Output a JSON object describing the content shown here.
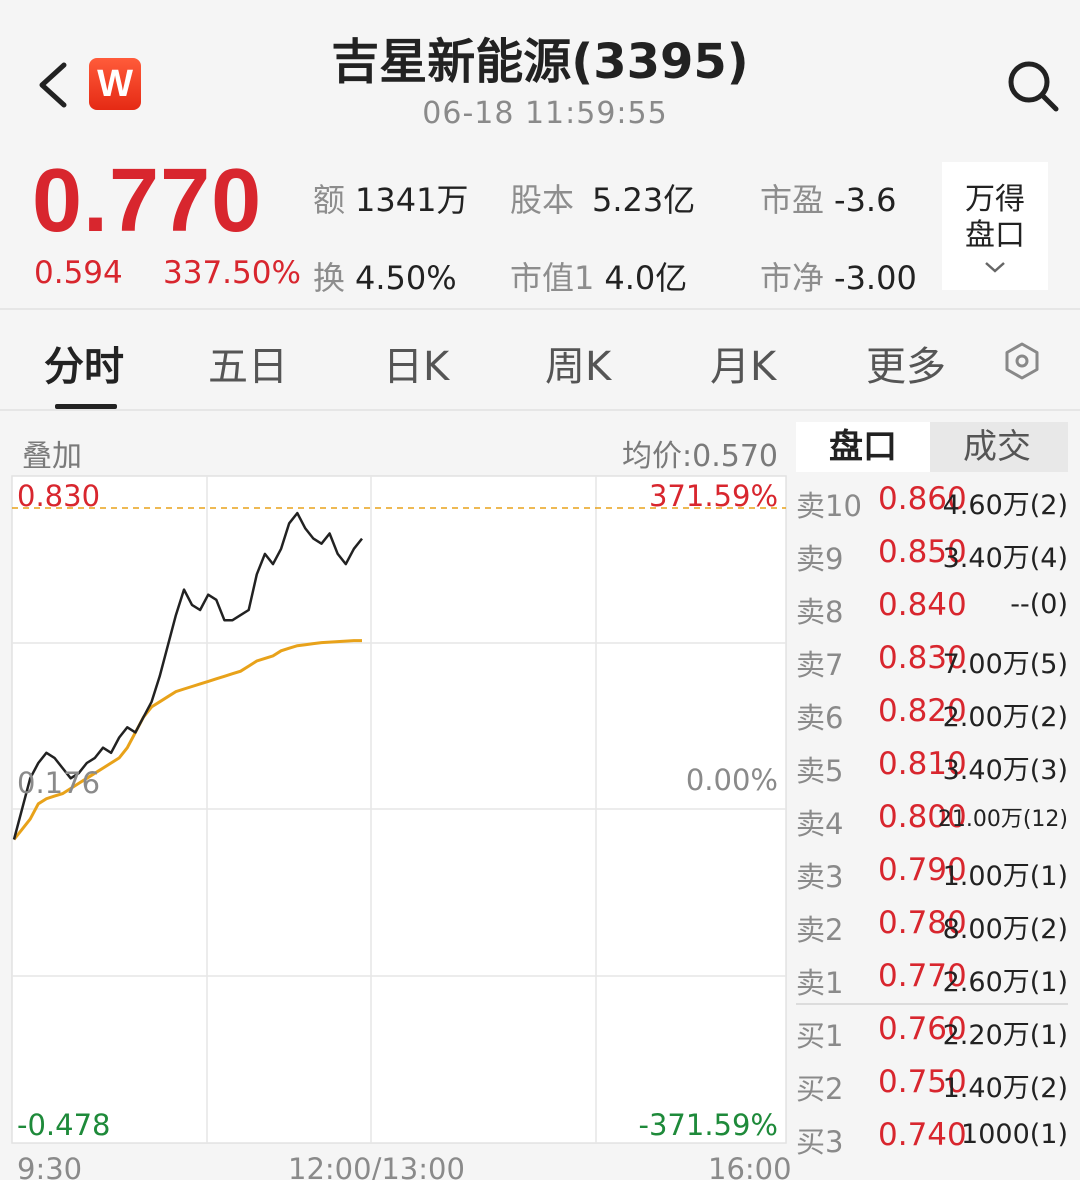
{
  "header": {
    "title": "吉星新能源(3395)",
    "timestamp": "06-18 11:59:55",
    "logo_letter": "W"
  },
  "quote": {
    "price": "0.770",
    "change": "0.594",
    "change_pct": "337.50%",
    "stats": [
      {
        "label": "额",
        "value": "1341万"
      },
      {
        "label": "股本",
        "value": "5.23亿"
      },
      {
        "label": "市盈",
        "value": "-3.6"
      },
      {
        "label": "换",
        "value": "4.50%"
      },
      {
        "label": "市值1",
        "value": "4.0亿"
      },
      {
        "label": "市净",
        "value": "-3.00"
      }
    ],
    "wande_label_1": "万得",
    "wande_label_2": "盘口"
  },
  "tabs": [
    "分时",
    "五日",
    "日K",
    "周K",
    "月K",
    "更多"
  ],
  "chart": {
    "overlay_label": "叠加",
    "avg_price_label": "均价:0.570",
    "top_price": "0.830",
    "top_pct": "371.59%",
    "mid_price": "0.176",
    "mid_pct": "0.00%",
    "bottom_price": "-0.478",
    "bottom_pct": "-371.59%",
    "time_labels": [
      "9:30",
      "12:00/13:00",
      "16:00"
    ]
  },
  "order_book": {
    "tabs": [
      "盘口",
      "成交"
    ],
    "rows": [
      {
        "level": "卖10",
        "price": "0.860",
        "volume": "4.60万(2)"
      },
      {
        "level": "卖9",
        "price": "0.850",
        "volume": "3.40万(4)"
      },
      {
        "level": "卖8",
        "price": "0.840",
        "volume": "--(0)"
      },
      {
        "level": "卖7",
        "price": "0.830",
        "volume": "7.00万(5)"
      },
      {
        "level": "卖6",
        "price": "0.820",
        "volume": "2.00万(2)"
      },
      {
        "level": "卖5",
        "price": "0.810",
        "volume": "3.40万(3)"
      },
      {
        "level": "卖4",
        "price": "0.800",
        "volume": "21.00万(12)"
      },
      {
        "level": "卖3",
        "price": "0.790",
        "volume": "1.00万(1)"
      },
      {
        "level": "卖2",
        "price": "0.780",
        "volume": "8.00万(2)"
      },
      {
        "level": "卖1",
        "price": "0.770",
        "volume": "2.60万(1)"
      },
      {
        "level": "买1",
        "price": "0.760",
        "volume": "2.20万(1)"
      },
      {
        "level": "买2",
        "price": "0.750",
        "volume": "1.40万(2)"
      },
      {
        "level": "买3",
        "price": "0.740",
        "volume": "1000(1)"
      }
    ]
  },
  "colors": {
    "up": "#d8262e",
    "down": "#1e8a3a",
    "avg_line": "#e8a21a",
    "price_line": "#222222"
  },
  "chart_data": {
    "type": "line",
    "ylim": [
      -0.478,
      0.83
    ],
    "x_range": [
      "9:30",
      "16:00"
    ],
    "series": [
      {
        "values": [
          0.18,
          0.24,
          0.3,
          0.33,
          0.35,
          0.34,
          0.32,
          0.3,
          0.31,
          0.33,
          0.34,
          0.36,
          0.35,
          0.38,
          0.4,
          0.39,
          0.42,
          0.45,
          0.5,
          0.56,
          0.62,
          0.67,
          0.64,
          0.63,
          0.66,
          0.65,
          0.61,
          0.61,
          0.62,
          0.63,
          0.7,
          0.74,
          0.72,
          0.75,
          0.8,
          0.82,
          0.79,
          0.77,
          0.76,
          0.78,
          0.74,
          0.72,
          0.75,
          0.77
        ],
        "color": "#222222"
      },
      {
        "values": [
          0.18,
          0.2,
          0.22,
          0.25,
          0.26,
          0.265,
          0.27,
          0.28,
          0.29,
          0.3,
          0.31,
          0.32,
          0.33,
          0.34,
          0.36,
          0.39,
          0.42,
          0.44,
          0.45,
          0.46,
          0.47,
          0.475,
          0.48,
          0.485,
          0.49,
          0.495,
          0.5,
          0.505,
          0.51,
          0.52,
          0.53,
          0.535,
          0.54,
          0.55,
          0.555,
          0.56,
          0.562,
          0.564,
          0.566,
          0.567,
          0.568,
          0.569,
          0.57,
          0.57
        ],
        "color": "#e8a21a"
      }
    ]
  }
}
